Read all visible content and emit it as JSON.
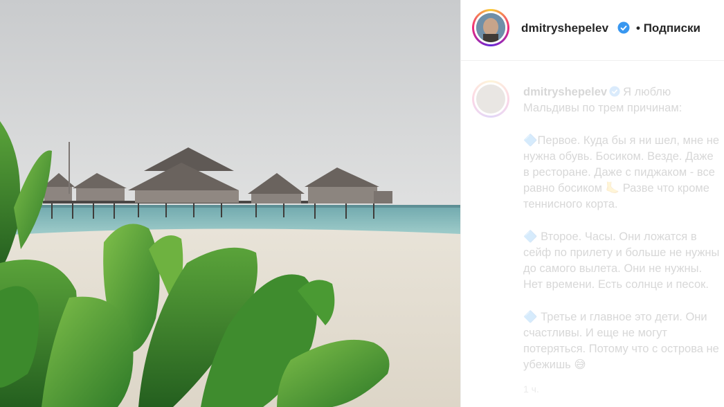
{
  "post": {
    "username": "dmitryshepelev",
    "separator": "•",
    "follow_label": "Подписки"
  },
  "caption": {
    "username": "dmitryshepelev",
    "text_first": "Я люблю\nМальдивы по трем причинам:",
    "line_1": "🔷Первое. Куда бы я ни шел, мне не\nнужна обувь. Босиком. Везде. Даже\nв ресторане. Даже с пиджаком - все\nравно босиком 🦶 Разве что кроме\nтеннисного корта.",
    "line_2": "🔷 Второе. Часы. Они ложатся в\nсейф по прилету и больше не нужны\nдо самого вылета. Они не нужны.\nНет времени. Есть солнце и песок.",
    "line_3": "🔷 Третье и главное это дети. Они\nсчастливы. И еще не могут\nпотеряться. Потому что с острова не\nубежишь 😅",
    "time": "1 ч."
  },
  "colors": {
    "verified_blue": "#3897f0",
    "text": "#262626",
    "story_ring": [
      "#f9ce34",
      "#ee2a7b",
      "#6228d7"
    ]
  },
  "icons": {
    "verified": "verified-badge-icon"
  }
}
